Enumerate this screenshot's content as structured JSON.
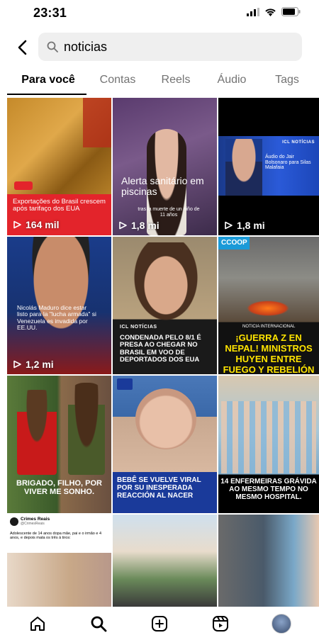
{
  "status": {
    "time": "23:31"
  },
  "search": {
    "query": "noticias"
  },
  "tabs": [
    "Para você",
    "Contas",
    "Reels",
    "Áudio",
    "Tags"
  ],
  "tiles": [
    {
      "caption": "Exportações do Brasil crescem após tarifaço dos EUA",
      "views": "164 mil"
    },
    {
      "caption": "Alerta sanitário em piscinas",
      "sub": "tras la muerte de un niño de 11 años",
      "views": "1,8 mi"
    },
    {
      "brand": "ICL NOTÍCIAS",
      "caption": "Áudio do Jair Bolsonaro para Silas Malafaia",
      "views": "1,8 mi"
    },
    {
      "caption": "Nicolás Maduro dice estar listo para la \"lucha armada\" si Venezuela es invadida por EE.UU.",
      "views": "1,2 mi"
    },
    {
      "brand": "ICL NOTÍCIAS",
      "caption": "CONDENADA PELO 8/1 É PRESA AO CHEGAR NO BRASIL EM VOO DE DEPORTADOS DOS EUA"
    },
    {
      "brand": "CCOOP",
      "label": "NOTICIA INTERNACIONAL",
      "caption": "¡GUERRA Z EN NEPAL! MINISTROS HUYEN ENTRE FUEGO Y REBELIÓN"
    },
    {
      "caption": "BRIGADO, FILHO, POR VIVER ME SONHO."
    },
    {
      "caption": "BEBÊ SE VUELVE VIRAL POR SU INESPERADA REACCIÓN AL NACER"
    },
    {
      "caption": "14 ENFERMEIRAS GRÁVIDA AO MESMO TEMPO NO MESMO HOSPITAL."
    },
    {
      "account": "Crimes Reais",
      "handle": "@CrimesReais",
      "caption": "Adolescente de 14 anos dopa mãe, pai e o irmão e 4 anos, e depois mata os três à tiros:"
    },
    {},
    {}
  ],
  "colors": {
    "accent": "#000000",
    "muted": "#737373",
    "searchbg": "#efefef"
  }
}
